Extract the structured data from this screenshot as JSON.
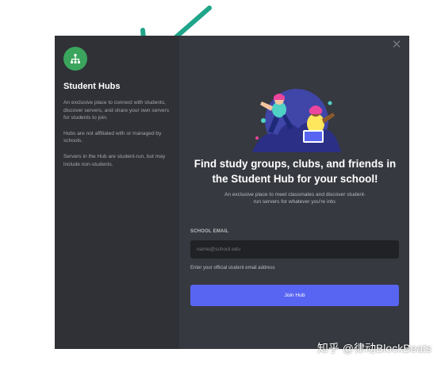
{
  "colors": {
    "sidebar_bg": "#2f3136",
    "main_bg": "#36393f",
    "accent": "#5865f2",
    "hub_green": "#3ba55d",
    "arrow": "#1fa58a",
    "input_bg": "#202225"
  },
  "sidebar": {
    "icon": "hub-icon",
    "title": "Student Hubs",
    "paragraphs": [
      "An exclusive place to connect with students, discover servers, and share your own servers for students to join.",
      "Hubs are not affiliated with or managed by schools.",
      "Servers in the Hub are student-run, but may include non-students."
    ]
  },
  "main": {
    "close_icon": "close-icon",
    "headline": "Find study groups, clubs, and friends in the Student Hub for your school!",
    "subtext": "An exclusive place to meet classmates and discover student-run servers for whatever you're into.",
    "email_label": "SCHOOL EMAIL",
    "email_placeholder": "name@school.edu",
    "email_value": "",
    "help_text": "Enter your official student email address",
    "join_label": "Join Hub"
  },
  "watermark": {
    "text": "知乎 @律动BlockBeats"
  }
}
